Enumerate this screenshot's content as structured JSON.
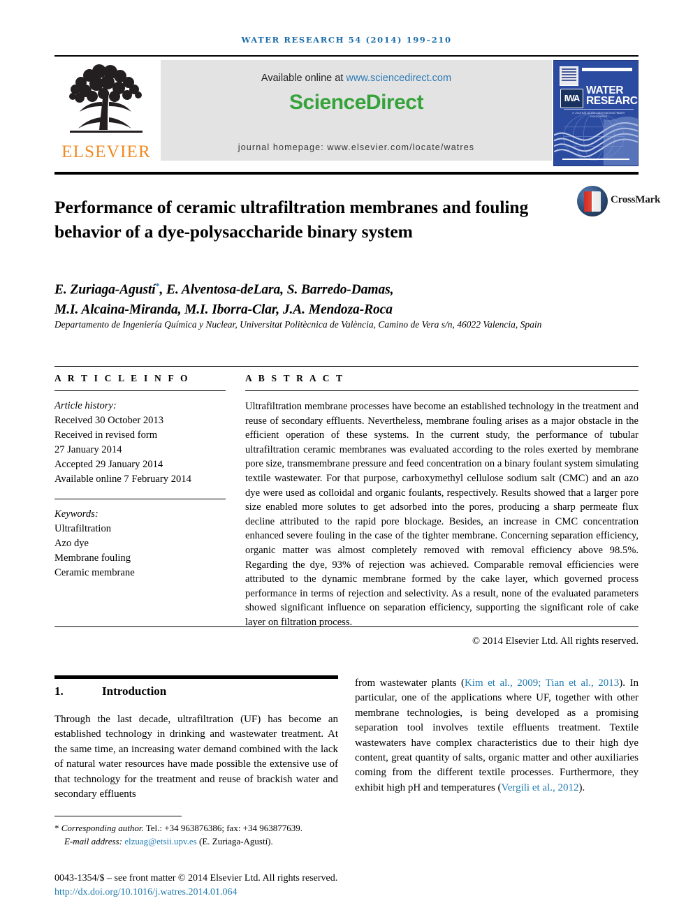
{
  "running_head": "WATER RESEARCH 54 (2014) 199–210",
  "masthead": {
    "publisher_name": "ELSEVIER",
    "available_text": "Available online at ",
    "available_link": "www.sciencedirect.com",
    "sciencedirect_logo": "ScienceDirect",
    "journal_homepage": "journal homepage: www.elsevier.com/locate/watres",
    "cover": {
      "title_line1": "WATER",
      "title_line2": "RESEARCH",
      "society_logo": "IWA",
      "society_line": "A Journal of the International Water Association"
    }
  },
  "article": {
    "title": "Performance of ceramic ultrafiltration membranes and fouling behavior of a dye-polysaccharide binary system",
    "crossmark_label": "CrossMark",
    "authors": "E. Zuriaga-Agustí*, E. Alventosa-deLara, S. Barredo-Damas, M.I. Alcaina-Miranda, M.I. Iborra-Clar, J.A. Mendoza-Roca",
    "authors_line1_pre": "E. Zuriaga-Agustí",
    "authors_line1_post": ", E. Alventosa-deLara, S. Barredo-Damas,",
    "authors_line2": "M.I. Alcaina-Miranda, M.I. Iborra-Clar, J.A. Mendoza-Roca",
    "corresponding_marker": "*",
    "affiliation": "Departamento de Ingeniería Química y Nuclear, Universitat Politècnica de València, Camino de Vera s/n, 46022 Valencia, Spain"
  },
  "article_info": {
    "heading": "A R T I C L E   I N F O",
    "history_label": "Article history:",
    "history": [
      "Received 30 October 2013",
      "Received in revised form",
      "27 January 2014",
      "Accepted 29 January 2014",
      "Available online 7 February 2014"
    ],
    "keywords_label": "Keywords:",
    "keywords": [
      "Ultrafiltration",
      "Azo dye",
      "Membrane fouling",
      "Ceramic membrane"
    ]
  },
  "abstract": {
    "heading": "A B S T R A C T",
    "body": "Ultrafiltration membrane processes have become an established technology in the treatment and reuse of secondary effluents. Nevertheless, membrane fouling arises as a major obstacle in the efficient operation of these systems. In the current study, the performance of tubular ultrafiltration ceramic membranes was evaluated according to the roles exerted by membrane pore size, transmembrane pressure and feed concentration on a binary foulant system simulating textile wastewater. For that purpose, carboxymethyl cellulose sodium salt (CMC) and an azo dye were used as colloidal and organic foulants, respectively. Results showed that a larger pore size enabled more solutes to get adsorbed into the pores, producing a sharp permeate flux decline attributed to the rapid pore blockage. Besides, an increase in CMC concentration enhanced severe fouling in the case of the tighter membrane. Concerning separation efficiency, organic matter was almost completely removed with removal efficiency above 98.5%. Regarding the dye, 93% of rejection was achieved. Comparable removal efficiencies were attributed to the dynamic membrane formed by the cake layer, which governed process performance in terms of rejection and selectivity. As a result, none of the evaluated parameters showed significant influence on separation efficiency, supporting the significant role of cake layer on filtration process.",
    "copyright": "© 2014 Elsevier Ltd. All rights reserved."
  },
  "introduction": {
    "number": "1.",
    "heading": "Introduction",
    "left_paragraph": "Through the last decade, ultrafiltration (UF) has become an established technology in drinking and wastewater treatment. At the same time, an increasing water demand combined with the lack of natural water resources have made possible the extensive use of that technology for the treatment and reuse of brackish water and secondary effluents",
    "right_pre": "from wastewater plants (",
    "right_cite1": "Kim et al., 2009; Tian et al., 2013",
    "right_mid": "). In particular, one of the applications where UF, together with other membrane technologies, is being developed as a promising separation tool involves textile effluents treatment. Textile wastewaters have complex characteristics due to their high dye content, great quantity of salts, organic matter and other auxiliaries coming from the different textile processes. Furthermore, they exhibit high pH and temperatures (",
    "right_cite2": "Vergili et al., 2012",
    "right_post": ")."
  },
  "footnote": {
    "marker": "*",
    "corresponding_label": "Corresponding author.",
    "contact": " Tel.: +34 963876386; fax: +34 963877639.",
    "email_label": "E-mail address: ",
    "email": "elzuag@etsii.upv.es",
    "email_owner": " (E. Zuriaga-Agustí)."
  },
  "footer": {
    "imprint": "0043-1354/$ – see front matter © 2014 Elsevier Ltd. All rights reserved.",
    "doi": "http://dx.doi.org/10.1016/j.watres.2014.01.064"
  },
  "colors": {
    "link": "#1f7ab0",
    "sciencedirect_green": "#35a23a",
    "elsevier_orange": "#F08A22",
    "cover_blue": "#2b4ba0",
    "running_head_blue": "#1a6ca8"
  }
}
